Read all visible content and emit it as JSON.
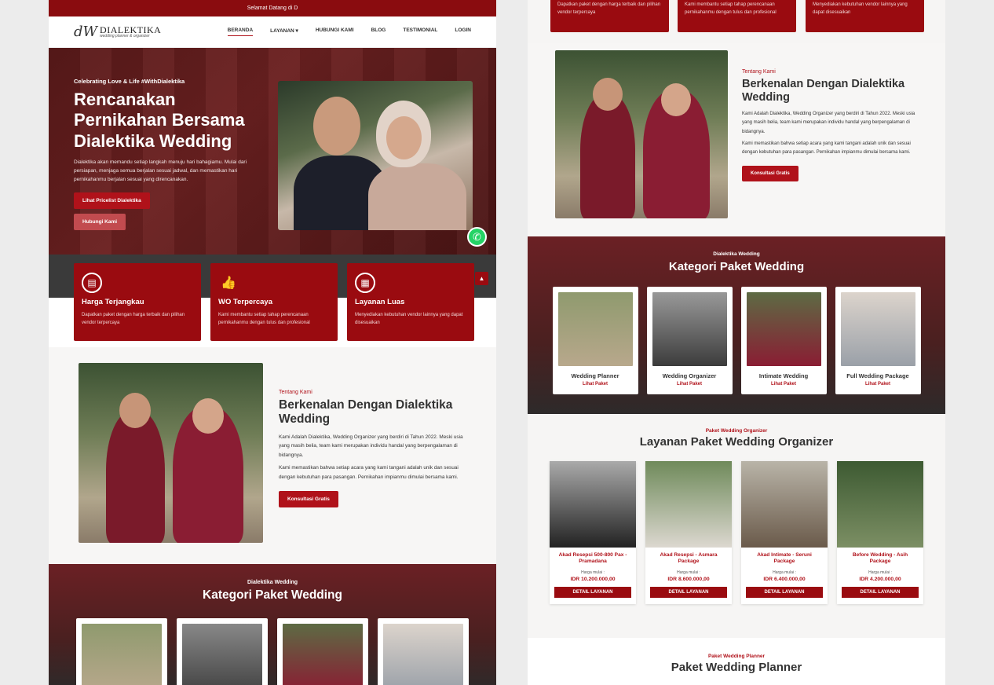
{
  "left": {
    "topbar": "Selamat Datang di D",
    "logo": {
      "mark": "dW",
      "name": "DIALEKTIKA",
      "tagline": "wedding planner & organizer"
    },
    "nav": [
      "BERANDA",
      "LAYANAN",
      "HUBUNGI KAMI",
      "BLOG",
      "TESTIMONIAL",
      "LOGIN"
    ],
    "hero": {
      "kicker": "Celebrating Love & Life #WithDialektika",
      "title": "Rencanakan Pernikahan Bersama Dialektika Wedding",
      "desc": "Dialektika akan memandu setiap langkah menuju hari bahagiamu. Mulai dari persiapan, menjaga semua berjalan sesuai jadwal, dan memastikan hari pernikahanmu berjalan sesuai yang direncanakan.",
      "btn_primary": "Lihat Pricelist Dialektika",
      "btn_secondary": "Hubungi Kami"
    },
    "features": [
      {
        "icon": "wallet-icon",
        "title": "Harga Terjangkau",
        "desc": "Dapatkan paket dengan harga terbaik dan pilihan vendor terpercaya"
      },
      {
        "icon": "thumbs-up-icon",
        "title": "WO Terpercaya",
        "desc": "Kami membantu setiap tahap perencanaan pernikahanmu dengan tulus dan profesional"
      },
      {
        "icon": "building-icon",
        "title": "Layanan Luas",
        "desc": "Menyediakan kebutuhan vendor lainnya yang dapat disesuaikan"
      }
    ],
    "about": {
      "kicker": "Tentang Kami",
      "title": "Berkenalan Dengan Dialektika Wedding",
      "p1": "Kami Adalah Dialektika, Wedding Organizer yang berdiri di Tahun 2022. Meski usia yang masih belia, team kami merupakan individu handal yang berpengalaman di bidangnya.",
      "p2": "Kami memastikan bahwa setiap acara yang kami tangani adalah unik dan sesuai dengan kebutuhan para pasangan. Pernikahan impianmu dimulai bersama kami.",
      "btn": "Konsultasi Gratis"
    },
    "category": {
      "kicker": "Dialektika Wedding",
      "title": "Kategori Paket Wedding"
    }
  },
  "right": {
    "features_top": [
      {
        "title": "Harga Terjangkau",
        "desc": "Dapatkan paket dengan harga terbaik dan pilihan vendor terpercaya"
      },
      {
        "title": "WO Terpercaya",
        "desc": "Kami membantu setiap tahap perencanaan pernikahanmu dengan tulus dan profesional"
      },
      {
        "title": "Layanan Luas",
        "desc": "Menyediakan kebutuhan vendor lainnya yang dapat disesuaikan"
      }
    ],
    "about": {
      "kicker": "Tentang Kami",
      "title": "Berkenalan Dengan Dialektika Wedding",
      "p1": "Kami Adalah Dialektika, Wedding Organizer yang berdiri di Tahun 2022. Meski usia yang masih belia, team kami merupakan individu handal yang berpengalaman di bidangnya.",
      "p2": "Kami memastikan bahwa setiap acara yang kami tangani adalah unik dan sesuai dengan kebutuhan para pasangan. Pernikahan impianmu dimulai bersama kami.",
      "btn": "Konsultasi Gratis"
    },
    "category": {
      "kicker": "Dialektika Wedding",
      "title": "Kategori Paket Wedding",
      "cards": [
        {
          "name": "Wedding Planner",
          "link": "Lihat Paket"
        },
        {
          "name": "Wedding Organizer",
          "link": "Lihat Paket"
        },
        {
          "name": "Intimate Wedding",
          "link": "Lihat Paket"
        },
        {
          "name": "Full Wedding Package",
          "link": "Lihat Paket"
        }
      ]
    },
    "services": {
      "kicker": "Paket Wedding Organizer",
      "title": "Layanan Paket Wedding Organizer",
      "items": [
        {
          "name": "Akad Resepsi 500-800 Pax - Pramadana",
          "from": "Harga mulai :",
          "price": "IDR 10.200.000,00",
          "btn": "DETAIL LAYANAN"
        },
        {
          "name": "Akad Resepsi - Asmara Package",
          "from": "Harga mulai :",
          "price": "IDR 8.600.000,00",
          "btn": "DETAIL LAYANAN"
        },
        {
          "name": "Akad Intimate - Seruni Package",
          "from": "Harga mulai :",
          "price": "IDR 6.400.000,00",
          "btn": "DETAIL LAYANAN"
        },
        {
          "name": "Before Wedding - Asih Package",
          "from": "Harga mulai :",
          "price": "IDR 4.200.000,00",
          "btn": "DETAIL LAYANAN"
        }
      ]
    },
    "planner": {
      "kicker": "Paket Wedding Planner",
      "title": "Paket Wedding Planner"
    }
  },
  "colors": {
    "brand": "#9a0b10",
    "accent": "#b0121a",
    "whatsapp": "#25d366"
  }
}
